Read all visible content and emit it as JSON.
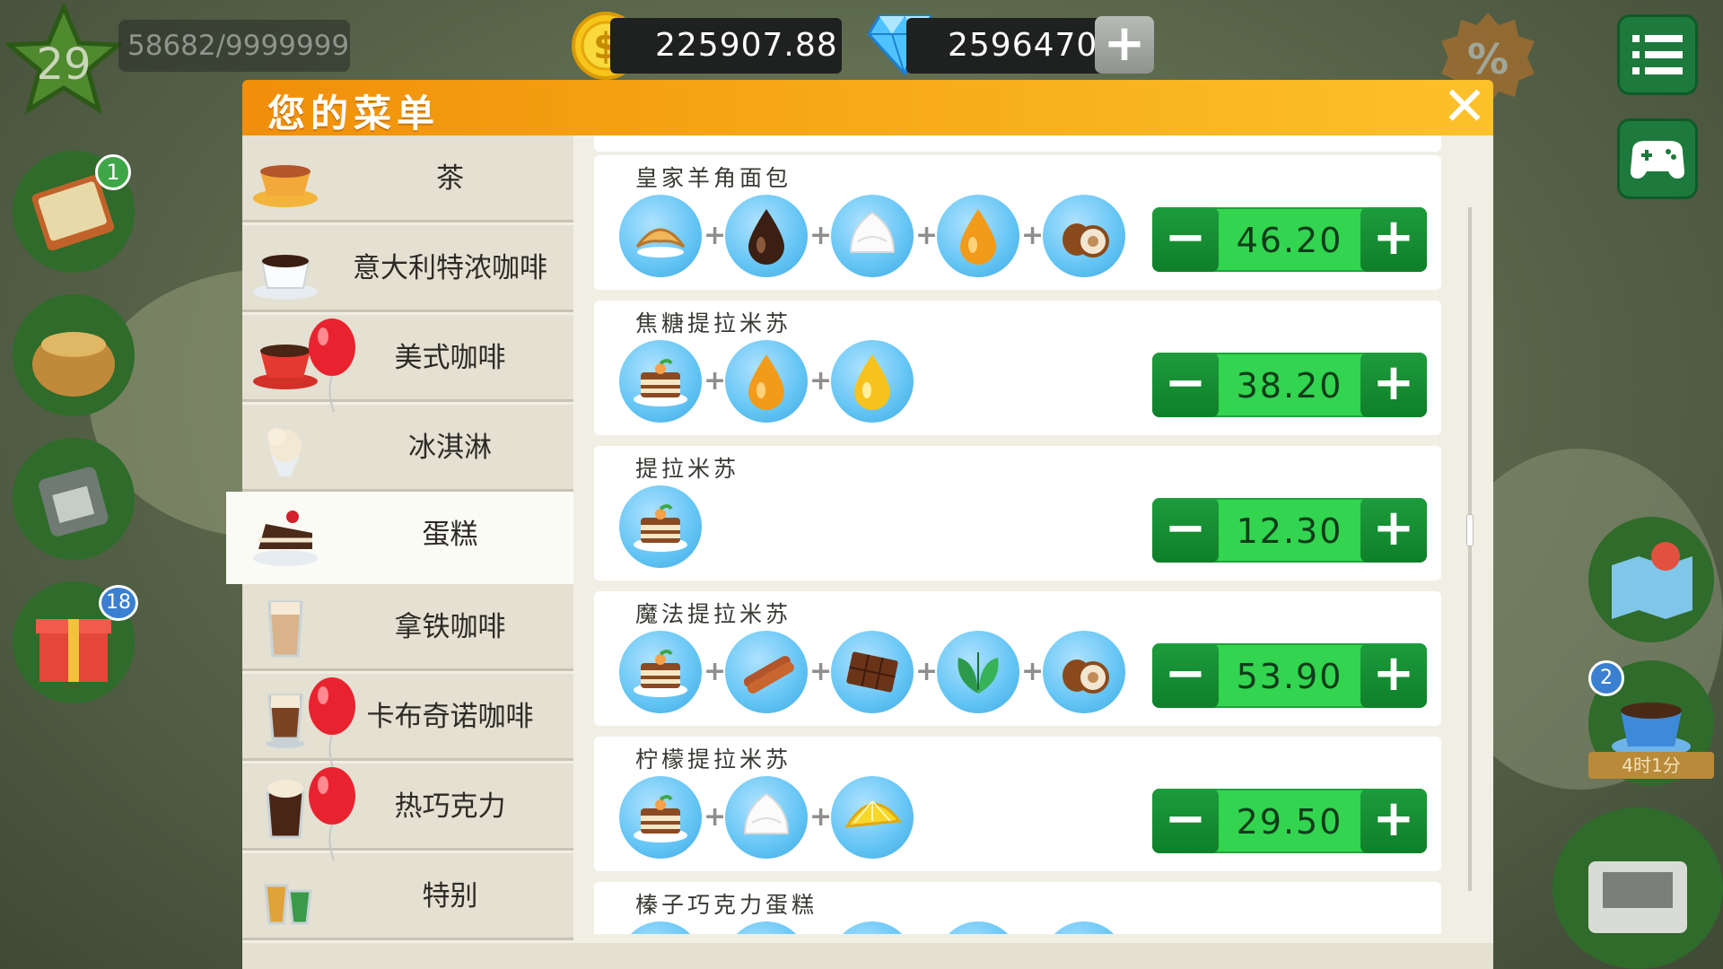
{
  "hud": {
    "level": "29",
    "xp": "58682/9999999",
    "coins": "225907.88",
    "gems": "2596470",
    "gems_add": "+",
    "notebook_badge": "1",
    "gift_badge": "18",
    "coffee_badge": "2",
    "coffee_timer": "4时1分"
  },
  "dialog": {
    "title": "您的菜单",
    "close": "✕"
  },
  "categories": [
    {
      "label": "茶",
      "icon": "tea-cup-icon"
    },
    {
      "label": "意大利特浓咖啡",
      "icon": "espresso-cup-icon"
    },
    {
      "label": "美式咖啡",
      "icon": "americano-cup-icon",
      "balloon": true
    },
    {
      "label": "冰淇淋",
      "icon": "ice-cream-icon"
    },
    {
      "label": "蛋糕",
      "icon": "cake-slice-icon",
      "active": true
    },
    {
      "label": "拿铁咖啡",
      "icon": "latte-glass-icon"
    },
    {
      "label": "卡布奇诺咖啡",
      "icon": "cappuccino-glass-icon",
      "balloon": true
    },
    {
      "label": "热巧克力",
      "icon": "hot-chocolate-icon",
      "balloon": true
    },
    {
      "label": "特别",
      "icon": "special-drinks-icon"
    }
  ],
  "recipes": [
    {
      "name": "皇家羊角面包",
      "ingredients": [
        "croissant",
        "chocolate-syrup",
        "whipped-cream",
        "caramel-drop",
        "hazelnut"
      ],
      "price": "46.20"
    },
    {
      "name": "焦糖提拉米苏",
      "ingredients": [
        "tiramisu",
        "caramel-drop",
        "honey-drop"
      ],
      "price": "38.20"
    },
    {
      "name": "提拉米苏",
      "ingredients": [
        "tiramisu"
      ],
      "price": "12.30"
    },
    {
      "name": "魔法提拉米苏",
      "ingredients": [
        "tiramisu",
        "cinnamon",
        "chocolate-bar",
        "mint",
        "hazelnut"
      ],
      "price": "53.90"
    },
    {
      "name": "柠檬提拉米苏",
      "ingredients": [
        "tiramisu",
        "whipped-cream",
        "lemon"
      ],
      "price": "29.50"
    },
    {
      "name": "榛子巧克力蛋糕",
      "ingredients": [],
      "price": ""
    }
  ],
  "colors": {
    "header_orange": "#f6a515",
    "price_green": "#33d44f",
    "button_green": "#0f7f2a",
    "ingredient_blue": "#62c4f4"
  }
}
